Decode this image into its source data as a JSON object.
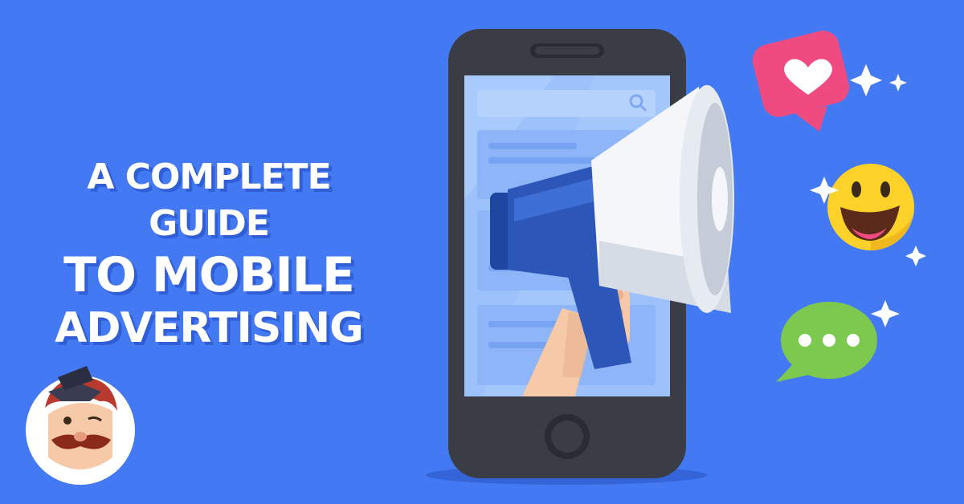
{
  "headline": {
    "line1": "A COMPLETE GUIDE",
    "line2": "TO MOBILE",
    "line3": "ADVERTISING"
  },
  "colors": {
    "background": "#4379f2",
    "text_shadow": "#2f5ed6",
    "phone_body": "#3a3d46",
    "screen": "#9cc1fb",
    "heart_bubble": "#f04b80",
    "emoji_yellow": "#fcd22a",
    "chat_bubble": "#7dc94f",
    "megaphone_blue": "#2c57b8",
    "megaphone_white": "#f4f6fa"
  },
  "icons": [
    "heart-icon",
    "smiley-emoji-icon",
    "chat-bubble-icon",
    "sparkle-icon",
    "megaphone-icon",
    "search-icon",
    "mascot-logo"
  ]
}
